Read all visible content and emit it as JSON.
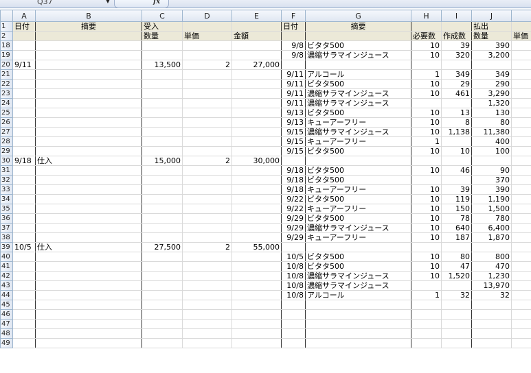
{
  "namebox": "Q37",
  "fx_label": "fx",
  "columns": [
    "A",
    "B",
    "C",
    "D",
    "E",
    "F",
    "G",
    "H",
    "I",
    "J",
    ""
  ],
  "rows": [
    {
      "n": "1",
      "A": "日付",
      "B": "摘要",
      "C": "受入",
      "D": "",
      "E": "",
      "F": "日付",
      "G": "摘要",
      "H": "",
      "I": "",
      "J": "払出",
      "K": ""
    },
    {
      "n": "2",
      "A": "",
      "B": "",
      "C": "数量",
      "D": "単価",
      "E": "金額",
      "F": "",
      "G": "",
      "H": "必要数",
      "I": "作成数",
      "J": "数量",
      "K": "単価"
    },
    {
      "n": "18",
      "A": "",
      "B": "",
      "C": "",
      "D": "",
      "E": "",
      "F": "9/8",
      "G": "ビタタ500",
      "H": "10",
      "I": "39",
      "J": "390",
      "K": ""
    },
    {
      "n": "19",
      "A": "",
      "B": "",
      "C": "",
      "D": "",
      "E": "",
      "F": "9/8",
      "G": "濃縮サラマインジュース",
      "H": "10",
      "I": "320",
      "J": "3,200",
      "K": ""
    },
    {
      "n": "20",
      "A": "9/11",
      "B": "",
      "C": "13,500",
      "D": "2",
      "E": "27,000",
      "F": "",
      "G": "",
      "H": "",
      "I": "",
      "J": "",
      "K": ""
    },
    {
      "n": "21",
      "A": "",
      "B": "",
      "C": "",
      "D": "",
      "E": "",
      "F": "9/11",
      "G": "アルコール",
      "H": "1",
      "I": "349",
      "J": "349",
      "K": ""
    },
    {
      "n": "22",
      "A": "",
      "B": "",
      "C": "",
      "D": "",
      "E": "",
      "F": "9/11",
      "G": "ビタタ500",
      "H": "10",
      "I": "29",
      "J": "290",
      "K": ""
    },
    {
      "n": "23",
      "A": "",
      "B": "",
      "C": "",
      "D": "",
      "E": "",
      "F": "9/11",
      "G": "濃縮サラマインジュース",
      "H": "10",
      "I": "461",
      "J": "3,290",
      "K": ""
    },
    {
      "n": "24",
      "A": "",
      "B": "",
      "C": "",
      "D": "",
      "E": "",
      "F": "9/11",
      "G": "濃縮サラマインジュース",
      "H": "",
      "I": "",
      "J": "1,320",
      "K": ""
    },
    {
      "n": "25",
      "A": "",
      "B": "",
      "C": "",
      "D": "",
      "E": "",
      "F": "9/13",
      "G": "ビタタ500",
      "H": "10",
      "I": "13",
      "J": "130",
      "K": ""
    },
    {
      "n": "26",
      "A": "",
      "B": "",
      "C": "",
      "D": "",
      "E": "",
      "F": "9/13",
      "G": "キューアーフリー",
      "H": "10",
      "I": "8",
      "J": "80",
      "K": ""
    },
    {
      "n": "27",
      "A": "",
      "B": "",
      "C": "",
      "D": "",
      "E": "",
      "F": "9/15",
      "G": "濃縮サラマインジュース",
      "H": "10",
      "I": "1,138",
      "J": "11,380",
      "K": ""
    },
    {
      "n": "28",
      "A": "",
      "B": "",
      "C": "",
      "D": "",
      "E": "",
      "F": "9/15",
      "G": "キューアーフリー",
      "H": "1",
      "I": "",
      "J": "400",
      "K": ""
    },
    {
      "n": "29",
      "A": "",
      "B": "",
      "C": "",
      "D": "",
      "E": "",
      "F": "9/15",
      "G": "ビタタ500",
      "H": "10",
      "I": "10",
      "J": "100",
      "K": ""
    },
    {
      "n": "30",
      "A": "9/18",
      "B": "仕入",
      "C": "15,000",
      "D": "2",
      "E": "30,000",
      "F": "",
      "G": "",
      "H": "",
      "I": "",
      "J": "",
      "K": ""
    },
    {
      "n": "31",
      "A": "",
      "B": "",
      "C": "",
      "D": "",
      "E": "",
      "F": "9/18",
      "G": "ビタタ500",
      "H": "10",
      "I": "46",
      "J": "90",
      "K": ""
    },
    {
      "n": "32",
      "A": "",
      "B": "",
      "C": "",
      "D": "",
      "E": "",
      "F": "9/18",
      "G": "ビタタ500",
      "H": "",
      "I": "",
      "J": "370",
      "K": ""
    },
    {
      "n": "33",
      "A": "",
      "B": "",
      "C": "",
      "D": "",
      "E": "",
      "F": "9/18",
      "G": "キューアーフリー",
      "H": "10",
      "I": "39",
      "J": "390",
      "K": ""
    },
    {
      "n": "34",
      "A": "",
      "B": "",
      "C": "",
      "D": "",
      "E": "",
      "F": "9/22",
      "G": "ビタタ500",
      "H": "10",
      "I": "119",
      "J": "1,190",
      "K": ""
    },
    {
      "n": "35",
      "A": "",
      "B": "",
      "C": "",
      "D": "",
      "E": "",
      "F": "9/22",
      "G": "キューアーフリー",
      "H": "10",
      "I": "150",
      "J": "1,500",
      "K": ""
    },
    {
      "n": "36",
      "A": "",
      "B": "",
      "C": "",
      "D": "",
      "E": "",
      "F": "9/29",
      "G": "ビタタ500",
      "H": "10",
      "I": "78",
      "J": "780",
      "K": ""
    },
    {
      "n": "37",
      "A": "",
      "B": "",
      "C": "",
      "D": "",
      "E": "",
      "F": "9/29",
      "G": "濃縮サラマインジュース",
      "H": "10",
      "I": "640",
      "J": "6,400",
      "K": ""
    },
    {
      "n": "38",
      "A": "",
      "B": "",
      "C": "",
      "D": "",
      "E": "",
      "F": "9/29",
      "G": "キューアーフリー",
      "H": "10",
      "I": "187",
      "J": "1,870",
      "K": ""
    },
    {
      "n": "39",
      "A": "10/5",
      "B": "仕入",
      "C": "27,500",
      "D": "2",
      "E": "55,000",
      "F": "",
      "G": "",
      "H": "",
      "I": "",
      "J": "",
      "K": ""
    },
    {
      "n": "40",
      "A": "",
      "B": "",
      "C": "",
      "D": "",
      "E": "",
      "F": "10/5",
      "G": "ビタタ500",
      "H": "10",
      "I": "80",
      "J": "800",
      "K": ""
    },
    {
      "n": "41",
      "A": "",
      "B": "",
      "C": "",
      "D": "",
      "E": "",
      "F": "10/8",
      "G": "ビタタ500",
      "H": "10",
      "I": "47",
      "J": "470",
      "K": ""
    },
    {
      "n": "42",
      "A": "",
      "B": "",
      "C": "",
      "D": "",
      "E": "",
      "F": "10/8",
      "G": "濃縮サラマインジュース",
      "H": "10",
      "I": "1,520",
      "J": "1,230",
      "K": ""
    },
    {
      "n": "43",
      "A": "",
      "B": "",
      "C": "",
      "D": "",
      "E": "",
      "F": "10/8",
      "G": "濃縮サラマインジュース",
      "H": "",
      "I": "",
      "J": "13,970",
      "K": ""
    },
    {
      "n": "44",
      "A": "",
      "B": "",
      "C": "",
      "D": "",
      "E": "",
      "F": "10/8",
      "G": "アルコール",
      "H": "1",
      "I": "32",
      "J": "32",
      "K": ""
    },
    {
      "n": "45",
      "A": "",
      "B": "",
      "C": "",
      "D": "",
      "E": "",
      "F": "",
      "G": "",
      "H": "",
      "I": "",
      "J": "",
      "K": ""
    },
    {
      "n": "46",
      "A": "",
      "B": "",
      "C": "",
      "D": "",
      "E": "",
      "F": "",
      "G": "",
      "H": "",
      "I": "",
      "J": "",
      "K": ""
    },
    {
      "n": "47",
      "A": "",
      "B": "",
      "C": "",
      "D": "",
      "E": "",
      "F": "",
      "G": "",
      "H": "",
      "I": "",
      "J": "",
      "K": ""
    },
    {
      "n": "48",
      "A": "",
      "B": "",
      "C": "",
      "D": "",
      "E": "",
      "F": "",
      "G": "",
      "H": "",
      "I": "",
      "J": "",
      "K": ""
    },
    {
      "n": "49",
      "A": "",
      "B": "",
      "C": "",
      "D": "",
      "E": "",
      "F": "",
      "G": "",
      "H": "",
      "I": "",
      "J": "",
      "K": ""
    }
  ]
}
